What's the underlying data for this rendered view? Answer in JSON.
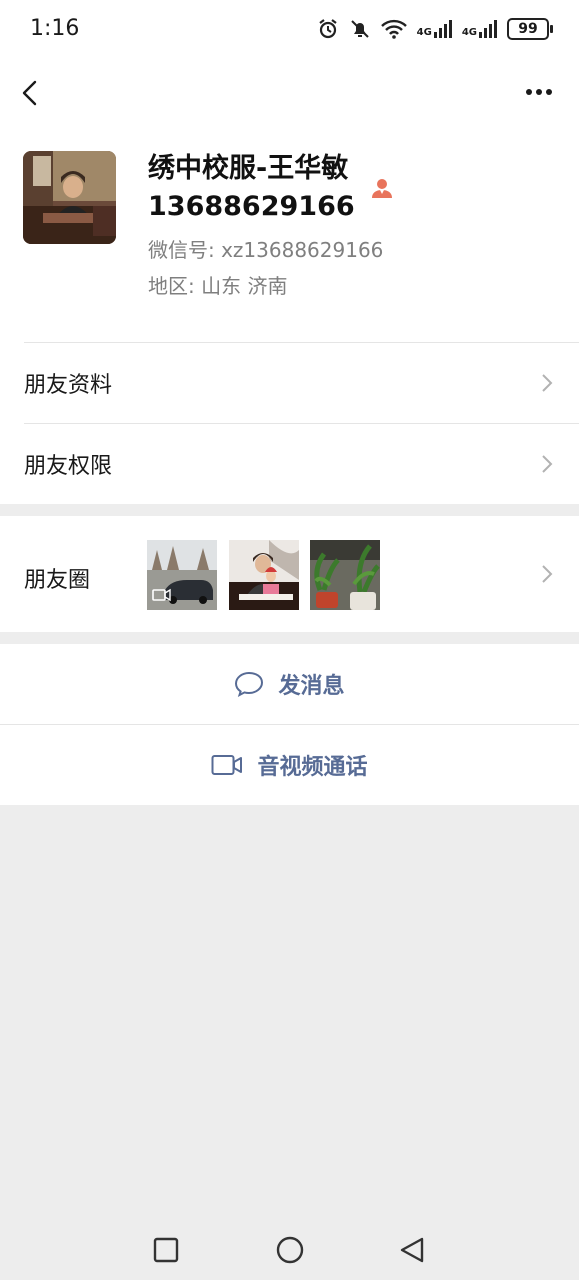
{
  "status_bar": {
    "time": "1:16",
    "network_1": "4G",
    "network_2": "4G",
    "battery": "99"
  },
  "nav": {
    "back_icon": "chevron-left-icon",
    "more_icon": "more-dots-icon"
  },
  "profile": {
    "name": "绣中校服-王华敏13688629166",
    "wechat_id": "微信号:  xz13688629166",
    "region": "地区:  山东  济南"
  },
  "menu": {
    "friend_info": "朋友资料",
    "friend_permissions": "朋友权限",
    "moments": "朋友圈"
  },
  "actions": {
    "message": "发消息",
    "video_call": "音视频通话"
  },
  "colors": {
    "link": "#576b95",
    "background": "#ededed",
    "badge": "#e8745c"
  }
}
